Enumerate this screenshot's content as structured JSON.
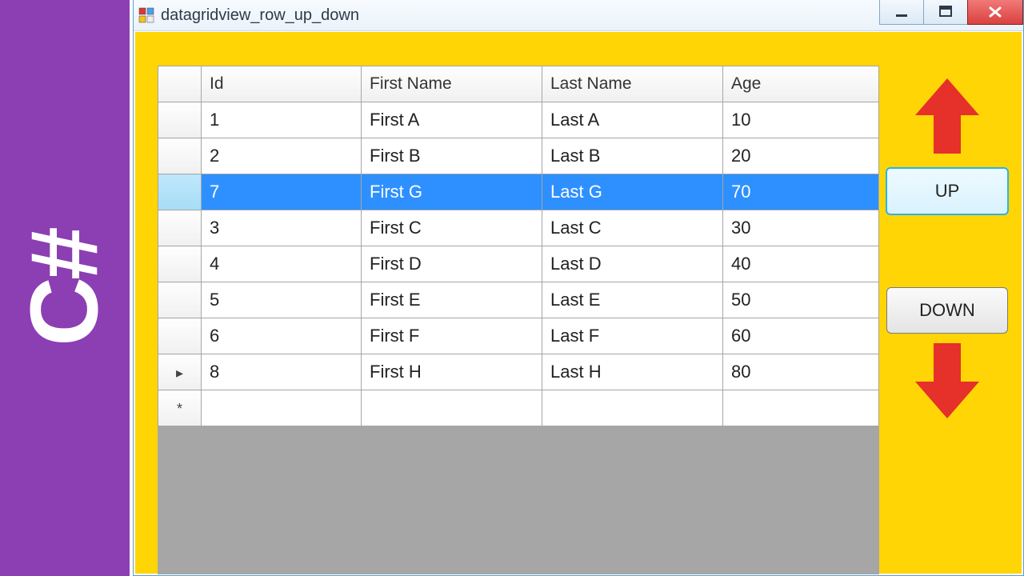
{
  "banner_text": "C#",
  "window": {
    "title": "datagridview_row_up_down"
  },
  "grid": {
    "columns": [
      "Id",
      "First Name",
      "Last Name",
      "Age"
    ],
    "rows": [
      {
        "marker": "",
        "id": "1",
        "first": "First A",
        "last": "Last A",
        "age": "10",
        "selected": false
      },
      {
        "marker": "",
        "id": "2",
        "first": "First B",
        "last": "Last B",
        "age": "20",
        "selected": false
      },
      {
        "marker": "",
        "id": "7",
        "first": "First G",
        "last": "Last G",
        "age": "70",
        "selected": true
      },
      {
        "marker": "",
        "id": "3",
        "first": "First C",
        "last": "Last C",
        "age": "30",
        "selected": false
      },
      {
        "marker": "",
        "id": "4",
        "first": "First D",
        "last": "Last D",
        "age": "40",
        "selected": false
      },
      {
        "marker": "",
        "id": "5",
        "first": "First E",
        "last": "Last E",
        "age": "50",
        "selected": false
      },
      {
        "marker": "",
        "id": "6",
        "first": "First F",
        "last": "Last F",
        "age": "60",
        "selected": false
      },
      {
        "marker": "▸",
        "id": "8",
        "first": "First H",
        "last": "Last H",
        "age": "80",
        "selected": false
      },
      {
        "marker": "*",
        "id": "",
        "first": "",
        "last": "",
        "age": "",
        "selected": false
      }
    ]
  },
  "buttons": {
    "up": "UP",
    "down": "DOWN"
  },
  "colors": {
    "arrow": "#e6302a",
    "banner": "#8b3fb2",
    "client": "#ffd506",
    "select": "#2e90ff"
  }
}
